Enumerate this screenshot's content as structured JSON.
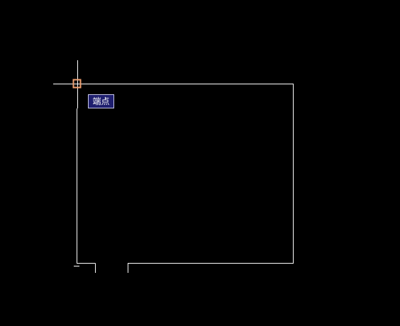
{
  "canvas": {
    "background_color": "#000000",
    "line_color": "#ffffff",
    "crosshair_color": "#ffffff",
    "snap_marker_color": "#f0a070"
  },
  "snap_tooltip": {
    "label": "端点",
    "background_color": "#1f1f6e",
    "text_color": "#ffffff"
  },
  "cursor": {
    "icon": "crosshair-cursor-icon"
  },
  "snap_marker": {
    "icon": "endpoint-snap-marker-icon"
  }
}
